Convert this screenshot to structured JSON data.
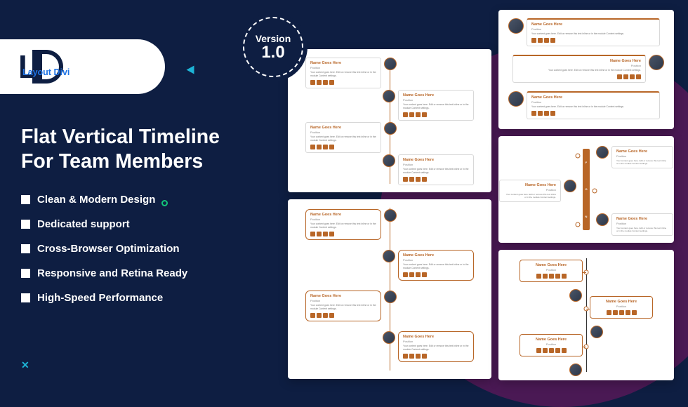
{
  "logo": {
    "primary": "LD",
    "sub": "Layout Divi"
  },
  "version": {
    "label": "Version",
    "number": "1.0"
  },
  "heading": {
    "line1": "Flat Vertical Timeline",
    "line2": "For Team Members"
  },
  "features": [
    "Clean & Modern Design",
    "Dedicated support",
    "Cross-Browser Optimization",
    "Responsive and Retina Ready",
    "High-Speed Performance"
  ],
  "entry": {
    "name": "Name Goes Here",
    "position": "Position",
    "desc": "Your content goes here. Edit or remove this text inline or in the module Content settings."
  },
  "colors": {
    "accent": "#b86627",
    "brandBg": "#0e1e42"
  }
}
